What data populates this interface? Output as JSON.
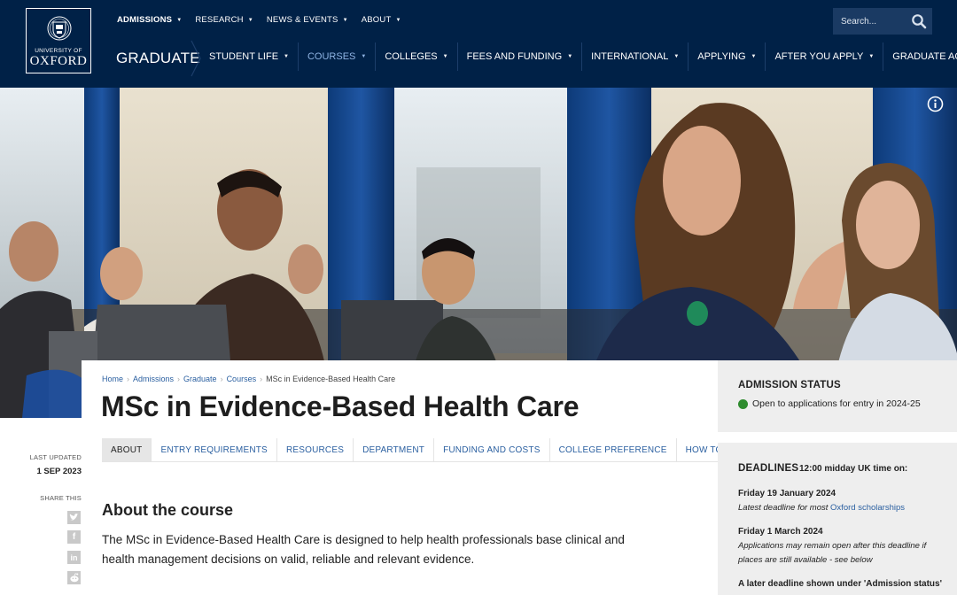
{
  "header": {
    "logo": {
      "small": "UNIVERSITY OF",
      "big": "OXFORD"
    },
    "top_nav": [
      {
        "label": "ADMISSIONS"
      },
      {
        "label": "RESEARCH"
      },
      {
        "label": "NEWS & EVENTS"
      },
      {
        "label": "ABOUT"
      }
    ],
    "search": {
      "placeholder": "Search..."
    },
    "section_title": "GRADUATE",
    "main_nav": [
      {
        "label": "STUDENT LIFE"
      },
      {
        "label": "COURSES"
      },
      {
        "label": "COLLEGES"
      },
      {
        "label": "FEES AND FUNDING"
      },
      {
        "label": "INTERNATIONAL"
      },
      {
        "label": "APPLYING"
      },
      {
        "label": "AFTER YOU APPLY"
      },
      {
        "label": "GRADUATE ACCESS"
      }
    ]
  },
  "breadcrumb": [
    "Home",
    "Admissions",
    "Graduate",
    "Courses",
    "MSc in Evidence-Based Health Care"
  ],
  "page_title": "MSc in Evidence-Based Health Care",
  "tabs": [
    "ABOUT",
    "ENTRY REQUIREMENTS",
    "RESOURCES",
    "DEPARTMENT",
    "FUNDING AND COSTS",
    "COLLEGE PREFERENCE",
    "HOW TO APPLY"
  ],
  "meta": {
    "last_updated_label": "LAST UPDATED",
    "last_updated_date": "1 SEP 2023",
    "share_label": "SHARE THIS"
  },
  "about": {
    "heading": "About the course",
    "text": "The MSc in Evidence-Based Health Care is designed to help health professionals base clinical and health management decisions on valid, reliable and relevant evidence."
  },
  "admission_status": {
    "title": "ADMISSION STATUS",
    "text": "Open to applications for entry in 2024-25",
    "color": "#2e8b2e"
  },
  "deadlines": {
    "title": "DEADLINES",
    "subtitle": "12:00 midday UK time on:",
    "d1_date": "Friday 19 January 2024",
    "d1_note_prefix": "Latest deadline for most ",
    "d1_note_link": "Oxford scholarships",
    "d2_date": "Friday 1 March 2024",
    "d2_note": "Applications may remain open after this deadline if places are still available - see below",
    "d3_date": "A later deadline shown under 'Admission status'"
  },
  "colors": {
    "brand_navy": "#002147",
    "link_blue": "#2a5fa0",
    "active_nav": "#8fb4e3"
  }
}
